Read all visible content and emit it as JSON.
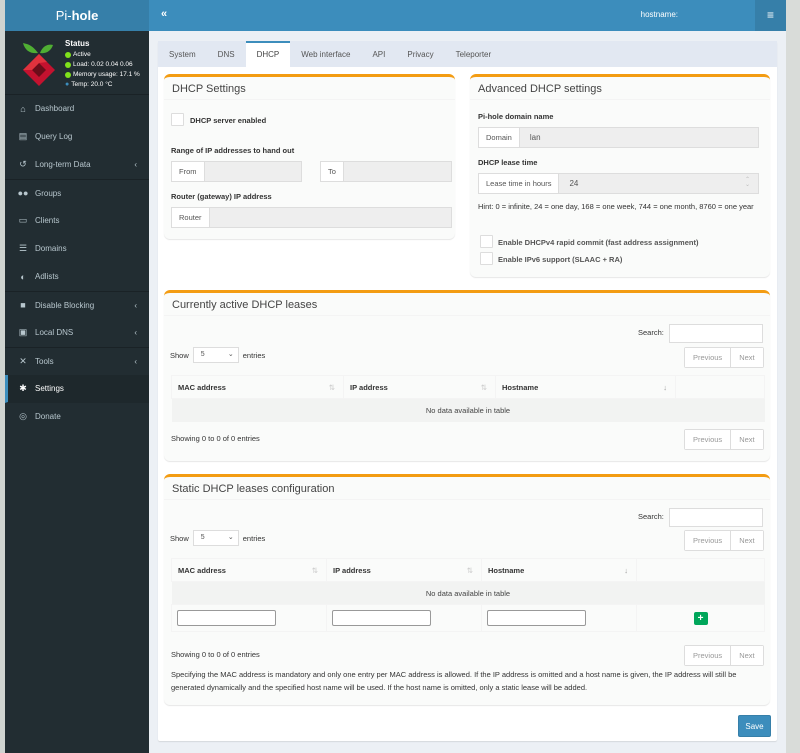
{
  "app": {
    "title_prefix": "Pi-",
    "title_suffix": "hole"
  },
  "header": {
    "collapse_icon": "«",
    "hostname_label": "hostname:",
    "menu_icon": "≡"
  },
  "status": {
    "title": "Status",
    "active": "Active",
    "load": "Load:  0.02  0.04  0.06",
    "memory": "Memory usage:  17.1 %",
    "temp": "Temp: 20.0 °C",
    "status_color": "#7fe01b"
  },
  "sidebar": {
    "items": [
      {
        "label": "Dashboard",
        "icon": "home-icon",
        "glyph": "⌂"
      },
      {
        "label": "Query Log",
        "icon": "file-icon",
        "glyph": "▤"
      },
      {
        "label": "Long-term Data",
        "icon": "history-icon",
        "glyph": "↺",
        "chevron": "‹"
      },
      {
        "label": "Groups",
        "icon": "users-icon",
        "glyph": "👥"
      },
      {
        "label": "Clients",
        "icon": "laptop-icon",
        "glyph": "▭"
      },
      {
        "label": "Domains",
        "icon": "list-icon",
        "glyph": "☰"
      },
      {
        "label": "Adlists",
        "icon": "shield-icon",
        "glyph": "◐"
      },
      {
        "label": "Disable Blocking",
        "icon": "stop-icon",
        "glyph": "■",
        "chevron": "‹"
      },
      {
        "label": "Local DNS",
        "icon": "address-book-icon",
        "glyph": "▣",
        "chevron": "‹"
      },
      {
        "label": "Tools",
        "icon": "tools-icon",
        "glyph": "✕",
        "chevron": "‹"
      },
      {
        "label": "Settings",
        "icon": "gear-icon",
        "glyph": "✱"
      },
      {
        "label": "Donate",
        "icon": "donate-icon",
        "glyph": "◎"
      }
    ],
    "active_index": 10
  },
  "tabs": [
    "System",
    "DNS",
    "DHCP",
    "Web interface",
    "API",
    "Privacy",
    "Teleporter"
  ],
  "active_tab": "DHCP",
  "dhcp_settings": {
    "title": "DHCP Settings",
    "server_enabled_label": "DHCP server enabled",
    "server_enabled": false,
    "range_label": "Range of IP addresses to hand out",
    "from_addon": "From",
    "from_value": "",
    "to_addon": "To",
    "to_value": "",
    "router_label": "Router (gateway) IP address",
    "router_addon": "Router",
    "router_value": ""
  },
  "advanced": {
    "title": "Advanced DHCP settings",
    "domain_label": "Pi-hole domain name",
    "domain_addon": "Domain",
    "domain_value": "lan",
    "lease_label": "DHCP lease time",
    "lease_addon": "Lease time in hours",
    "lease_value": "24",
    "hint": "Hint: 0 = infinite, 24 = one day, 168 = one week, 744 = one month, 8760 = one year",
    "rapid_commit_label": "Enable DHCPv4 rapid commit (fast address assignment)",
    "rapid_commit": false,
    "ipv6_label": "Enable IPv6 support (SLAAC + RA)",
    "ipv6": false
  },
  "active_leases": {
    "title": "Currently active DHCP leases",
    "search_label": "Search:",
    "search_value": "",
    "show_label": "Show",
    "entries_label": "entries",
    "page_size": "5",
    "columns": [
      "MAC address",
      "IP address",
      "Hostname"
    ],
    "empty_text": "No data available in table",
    "info": "Showing 0 to 0 of 0 entries",
    "prev": "Previous",
    "next": "Next"
  },
  "static_leases": {
    "title": "Static DHCP leases configuration",
    "search_label": "Search:",
    "search_value": "",
    "show_label": "Show",
    "entries_label": "entries",
    "page_size": "5",
    "columns": [
      "MAC address",
      "IP address",
      "Hostname"
    ],
    "empty_text": "No data available in table",
    "add_icon": "+",
    "info": "Showing 0 to 0 of 0 entries",
    "prev": "Previous",
    "next": "Next",
    "note": "Specifying the MAC address is mandatory and only one entry per MAC address is allowed. If the IP address is omitted and a host name is given, the IP address will still be generated dynamically and the specified host name will be used. If the host name is omitted, only a static lease will be added."
  },
  "save_label": "Save",
  "colors": {
    "accent": "#3c8dbc",
    "box_border": "#f39c12",
    "sidebar_bg": "#222d32",
    "add_button": "#00a65a"
  }
}
